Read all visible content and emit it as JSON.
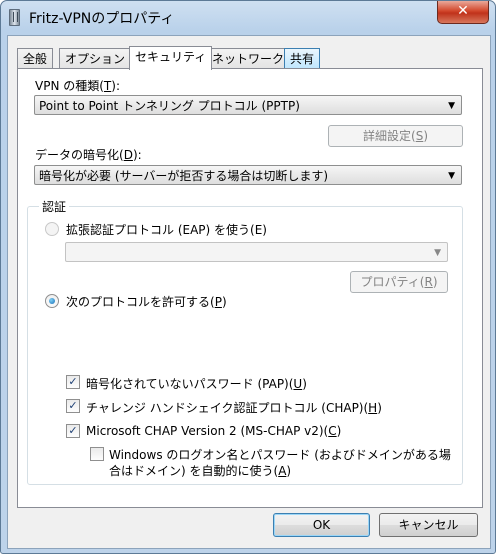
{
  "window": {
    "title": "Fritz-VPNのプロパティ",
    "close_glyph": "✕"
  },
  "tabs": [
    {
      "label": "全般"
    },
    {
      "label": "オプション"
    },
    {
      "label": "セキュリティ"
    },
    {
      "label": "ネットワーク"
    },
    {
      "label": "共有"
    }
  ],
  "vpn_type": {
    "label_prefix": "VPN の種類(",
    "label_key": "T",
    "label_suffix": "):",
    "value": "Point to Point トンネリング プロトコル (PPTP)"
  },
  "advanced_settings": {
    "prefix": "詳細設定(",
    "key": "S",
    "suffix": ")"
  },
  "encryption": {
    "label_prefix": "データの暗号化(",
    "label_key": "D",
    "label_suffix": "):",
    "value": "暗号化が必要 (サーバーが拒否する場合は切断します)"
  },
  "auth": {
    "group_title": "認証",
    "eap_radio": "拡張認証プロトコル (EAP) を使う(E)",
    "eap_combo_value": "",
    "properties": {
      "prefix": "プロパティ(",
      "key": "R",
      "suffix": ")"
    },
    "allow_radio": {
      "prefix": "次のプロトコルを許可する(",
      "key": "P",
      "suffix": ")"
    },
    "pap": {
      "prefix": "暗号化されていないパスワード (PAP)(",
      "key": "U",
      "suffix": ")"
    },
    "chap": {
      "prefix": "チャレンジ ハンドシェイク認証プロトコル (CHAP)(",
      "key": "H",
      "suffix": ")"
    },
    "mschap": {
      "prefix": "Microsoft CHAP Version 2 (MS-CHAP v2)(",
      "key": "C",
      "suffix": ")"
    },
    "windows_logon_line1": "Windows のログオン名とパスワード (およびドメインがある場",
    "windows_logon_line2_prefix": "合はドメイン) を自動的に使う(",
    "windows_logon_key": "A",
    "windows_logon_line2_suffix": ")"
  },
  "buttons": {
    "ok": "OK",
    "cancel": "キャンセル"
  },
  "state": {
    "selected_tab": "セキュリティ",
    "eap_selected": false,
    "allow_selected": true,
    "pap_checked": true,
    "chap_checked": true,
    "mschap_checked": true,
    "windows_logon_checked": false
  }
}
